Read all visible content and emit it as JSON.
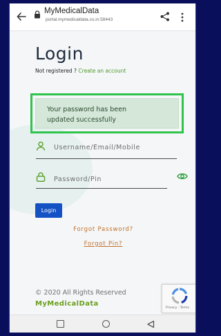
{
  "browser": {
    "site_title": "MyMedicalData",
    "url": "portal.mymedicaldata.co.in:58443"
  },
  "login": {
    "title": "Login",
    "not_registered": "Not registered ?",
    "create_account": "Create an account",
    "alert_line1": "Your password has been",
    "alert_line2": "updated successfully",
    "username_placeholder": "Username/Email/Mobile",
    "password_placeholder": "Password/Pin",
    "login_button": "Login",
    "forgot_password": "Forgot Password?",
    "forgot_pin": "Forgot Pin?"
  },
  "footer": {
    "copyright": "© 2020 All Rights Reserved",
    "brand": "MyMedicalData",
    "recaptcha_links": "Privacy - Terms"
  },
  "colors": {
    "accent_green": "#4c9a26",
    "alert_border": "#2ec34a",
    "button_blue": "#1451c4",
    "link_orange": "#c2702a"
  }
}
